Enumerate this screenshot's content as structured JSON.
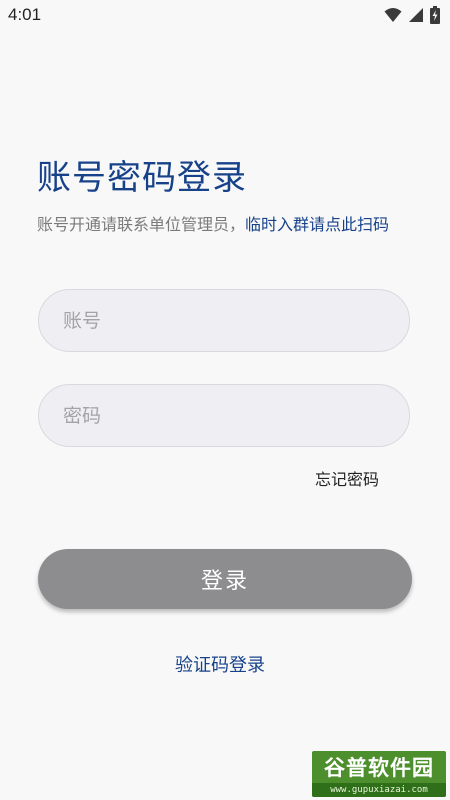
{
  "status_bar": {
    "time": "4:01"
  },
  "header": {
    "title": "账号密码登录",
    "subtitle_text": "账号开通请联系单位管理员，",
    "subtitle_link": "临时入群请点此扫码"
  },
  "form": {
    "account_placeholder": "账号",
    "password_placeholder": "密码",
    "forgot_password": "忘记密码",
    "login_button": "登录",
    "sms_login": "验证码登录"
  },
  "watermark": {
    "brand": "谷普软件园",
    "url": "www.gupuxiazai.com"
  },
  "colors": {
    "accent": "#17428a",
    "button": "#8d8d90",
    "background": "#f8f8f8",
    "input_bg": "#eeeef3"
  },
  "icons": [
    "wifi-icon",
    "signal-icon",
    "battery-icon"
  ]
}
